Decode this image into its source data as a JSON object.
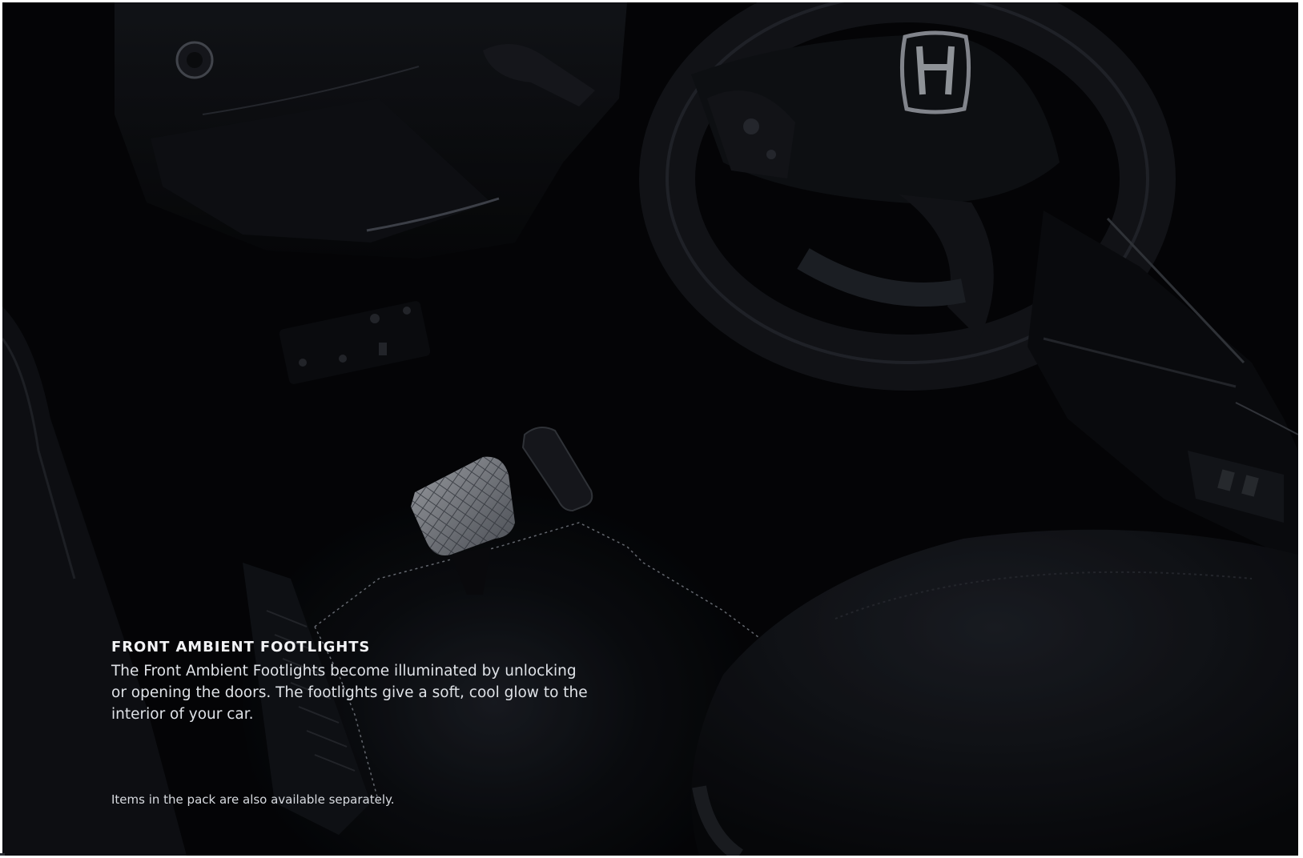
{
  "feature": {
    "heading": "FRONT AMBIENT FOOTLIGHTS",
    "body_lines": [
      "The Front Ambient Footlights become illuminated by unlocking",
      "or opening the doors. The footlights give a soft, cool glow to the",
      "interior of your car."
    ]
  },
  "footnote": "Items in the pack are also available separately.",
  "photo": {
    "subject": "car-interior-footwell-photo",
    "logo_icon": "honda-h-logo-icon"
  },
  "colors": {
    "background": "#050608",
    "text": "#e6e8ec"
  }
}
